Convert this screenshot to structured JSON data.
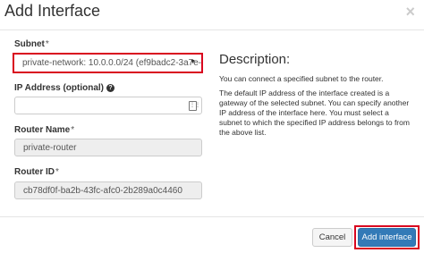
{
  "modal": {
    "title": "Add Interface",
    "close_glyph": "×"
  },
  "form": {
    "subnet": {
      "label": "Subnet",
      "required_mark": "*",
      "selected_value": "private-network: 10.0.0.0/24 (ef9badc2-3a7e-",
      "caret": "▼"
    },
    "ip_address": {
      "label": "IP Address (optional)",
      "help_icon": "question-circle-icon",
      "value": "",
      "field_icon": "keypad-icon"
    },
    "router_name": {
      "label": "Router Name",
      "required_mark": "*",
      "value": "private-router"
    },
    "router_id": {
      "label": "Router ID",
      "required_mark": "*",
      "value": "cb78df0f-ba2b-43fc-afc0-2b289a0c4460"
    }
  },
  "description": {
    "title": "Description:",
    "paragraph1": "You can connect a specified subnet to the router.",
    "paragraph2": "The default IP address of the interface created is a gateway of the selected subnet. You can specify another IP address of the interface here. You must select a subnet to which the specified IP address belongs to from the above list."
  },
  "footer": {
    "cancel_label": "Cancel",
    "submit_label": "Add interface"
  },
  "colors": {
    "primary": "#337ab7",
    "highlight": "#d9061f"
  }
}
